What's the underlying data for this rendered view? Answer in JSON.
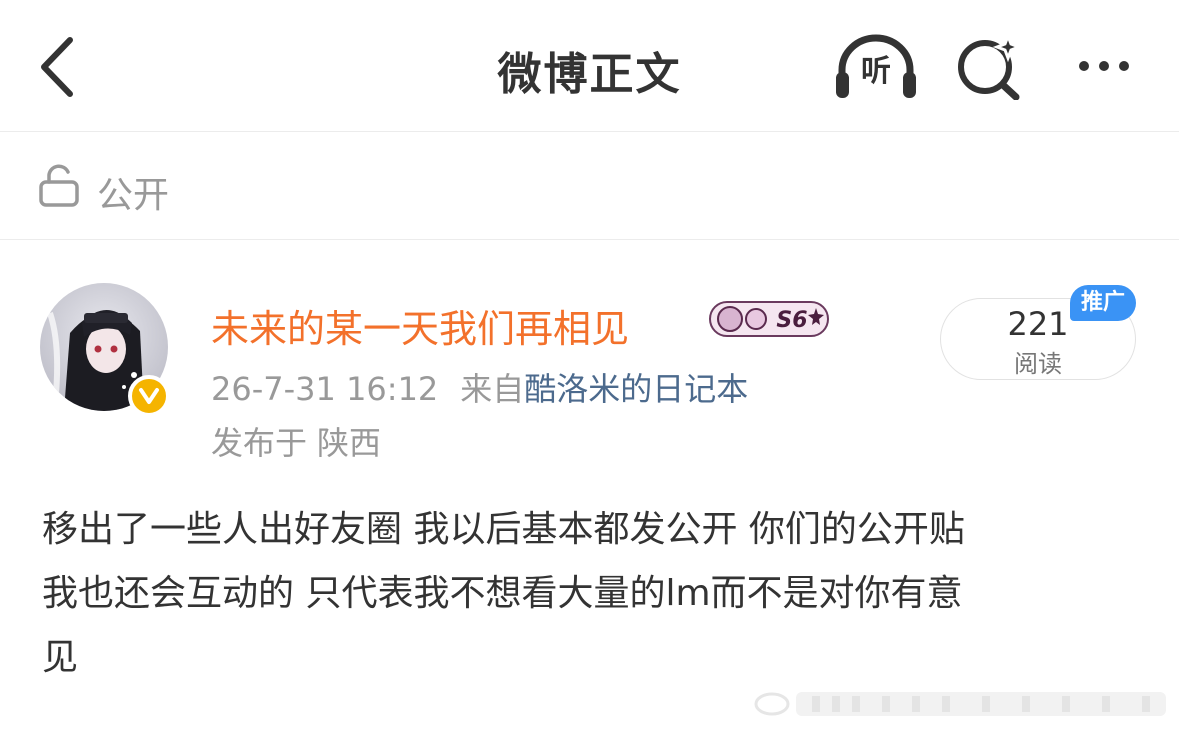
{
  "navbar": {
    "title": "微博正文",
    "listen_label": "听"
  },
  "visibility": {
    "label": "公开"
  },
  "author": {
    "name": "未来的某一天我们再相见",
    "vip_badge_text": "S6",
    "verified": true
  },
  "meta": {
    "time": "26-7-31 16:12",
    "from_label": "来自",
    "source": "酷洛米的日记本",
    "location_prefix": "发布于",
    "location": "陕西"
  },
  "stats": {
    "read_count": "221",
    "read_label": "阅读",
    "promo_label": "推广"
  },
  "post": {
    "lines": [
      "移出了一些人出好友圈 我以后基本都发公开 你们的公开贴",
      "我也还会互动的 只代表我不想看大量的lm而不是对你有意",
      "见"
    ]
  },
  "colors": {
    "username": "#f3712b",
    "source_link": "#4c6a8d",
    "meta_gray": "#999999",
    "promo_blue": "#3a93f5",
    "verified_gold": "#f5b400"
  },
  "icons": {
    "back": "chevron-left-icon",
    "listen": "headphones-icon",
    "search": "sparkle-search-icon",
    "more": "more-dots-icon",
    "visibility": "unlock-icon",
    "verified": "verified-v-icon"
  }
}
